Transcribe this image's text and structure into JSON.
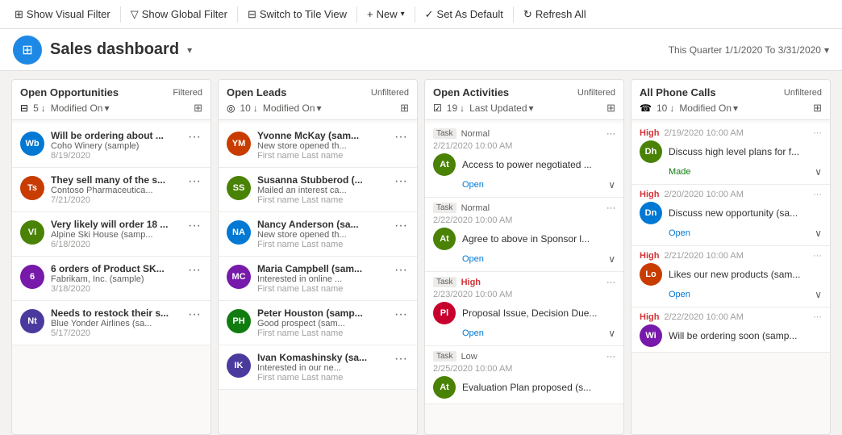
{
  "toolbar": {
    "show_visual_filter": "Show Visual Filter",
    "show_global_filter": "Show Global Filter",
    "switch_to_tile_view": "Switch to Tile View",
    "new_label": "New",
    "set_as_default": "Set As Default",
    "refresh_all": "Refresh All"
  },
  "header": {
    "title": "Sales dashboard",
    "quarter_label": "This Quarter 1/1/2020 To 3/31/2020"
  },
  "columns": {
    "open_opportunities": {
      "title": "Open Opportunities",
      "filter": "Filtered",
      "count": "5",
      "sort": "Modified On",
      "cards": [
        {
          "initials": "Wb",
          "color": "#0078d4",
          "name": "Will be ordering about ...",
          "sub": "Coho Winery (sample)",
          "date": "8/19/2020"
        },
        {
          "initials": "Ts",
          "color": "#c83c00",
          "name": "They sell many of the s...",
          "sub": "Contoso Pharmaceutica...",
          "date": "7/21/2020"
        },
        {
          "initials": "Vl",
          "color": "#498205",
          "name": "Very likely will order 18 ...",
          "sub": "Alpine Ski House (samp...",
          "date": "6/18/2020"
        },
        {
          "initials": "6",
          "color": "#7719aa",
          "name": "6 orders of Product SK...",
          "sub": "Fabrikam, Inc. (sample)",
          "date": "3/18/2020"
        },
        {
          "initials": "Nt",
          "color": "#4b3a9e",
          "name": "Needs to restock their s...",
          "sub": "Blue Yonder Airlines (sa...",
          "date": "5/17/2020"
        }
      ]
    },
    "open_leads": {
      "title": "Open Leads",
      "filter": "Unfiltered",
      "count": "10",
      "sort": "Modified On",
      "cards": [
        {
          "initials": "YM",
          "color": "#c83c00",
          "name": "Yvonne McKay (sam...",
          "sub": "New store opened th...",
          "hint": "First name Last name"
        },
        {
          "initials": "SS",
          "color": "#498205",
          "name": "Susanna Stubberod (...",
          "sub": "Mailed an interest ca...",
          "hint": "First name Last name"
        },
        {
          "initials": "NA",
          "color": "#0078d4",
          "name": "Nancy Anderson (sa...",
          "sub": "New store opened th...",
          "hint": "First name Last name"
        },
        {
          "initials": "MC",
          "color": "#7719aa",
          "name": "Maria Campbell (sam...",
          "sub": "Interested in online ...",
          "hint": "First name Last name"
        },
        {
          "initials": "PH",
          "color": "#107c10",
          "name": "Peter Houston (samp...",
          "sub": "Good prospect (sam...",
          "hint": "First name Last name"
        },
        {
          "initials": "IK",
          "color": "#4b3a9e",
          "name": "Ivan Komashinsky (sa...",
          "sub": "Interested in our ne...",
          "hint": "First name Last name"
        }
      ]
    },
    "open_activities": {
      "title": "Open Activities",
      "filter": "Unfiltered",
      "count": "19",
      "sort": "Last Updated",
      "cards": [
        {
          "type": "Task",
          "priority": "Normal",
          "datetime": "2/21/2020 10:00 AM",
          "avatar_color": "#498205",
          "avatar_initials": "At",
          "title": "Access to power negotiated ...",
          "status": "Open"
        },
        {
          "type": "Task",
          "priority": "Normal",
          "datetime": "2/22/2020 10:00 AM",
          "avatar_color": "#498205",
          "avatar_initials": "At",
          "title": "Agree to above in Sponsor l...",
          "status": "Open"
        },
        {
          "type": "Task",
          "priority": "High",
          "datetime": "2/23/2020 10:00 AM",
          "avatar_color": "#c8002d",
          "avatar_initials": "Pl",
          "title": "Proposal Issue, Decision Due...",
          "status": "Open"
        },
        {
          "type": "Task",
          "priority": "Low",
          "datetime": "2/25/2020 10:00 AM",
          "avatar_color": "#498205",
          "avatar_initials": "At",
          "title": "Evaluation Plan proposed (s...",
          "status": "Open"
        }
      ]
    },
    "all_phone_calls": {
      "title": "All Phone Calls",
      "filter": "Unfiltered",
      "count": "10",
      "sort": "Modified On",
      "cards": [
        {
          "priority": "High",
          "datetime": "2/19/2020 10:00 AM",
          "avatar_color": "#498205",
          "avatar_initials": "Dh",
          "title": "Discuss high level plans for f...",
          "status": ""
        },
        {
          "priority": "High",
          "datetime": "2/20/2020 10:00 AM",
          "avatar_color": "#0078d4",
          "avatar_initials": "Dn",
          "title": "Discuss new opportunity (sa...",
          "status": "Open",
          "status_type": "open"
        },
        {
          "priority": "High",
          "datetime": "2/21/2020 10:00 AM",
          "avatar_color": "#c83c00",
          "avatar_initials": "Lo",
          "title": "Likes our new products (sam...",
          "status": "Open",
          "status_type": "open"
        },
        {
          "priority": "High",
          "datetime": "2/22/2020 10:00 AM",
          "avatar_color": "#7719aa",
          "avatar_initials": "Wi",
          "title": "Will be ordering soon (samp...",
          "status": "",
          "status_type": ""
        }
      ]
    }
  }
}
